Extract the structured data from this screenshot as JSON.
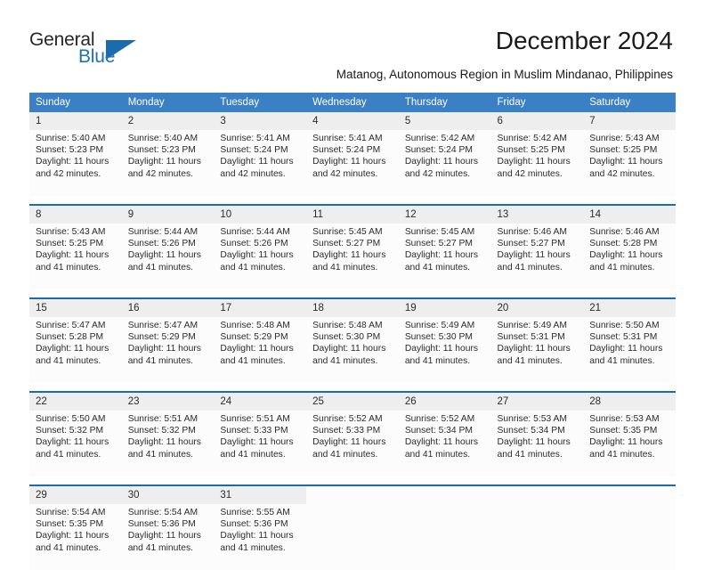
{
  "brand": {
    "name_part1": "General",
    "name_part2": "Blue",
    "accent_color": "#1b6cad",
    "triangle_icon": "triangle-icon"
  },
  "header": {
    "month_title": "December 2024",
    "location": "Matanog, Autonomous Region in Muslim Mindanao, Philippines"
  },
  "theme": {
    "header_row_bg": "#3b7fc4",
    "daynum_bg": "#eeeeee",
    "cell_bg": "#fcfcfc",
    "separator": "#1b6cad",
    "text": "#2b2b2b"
  },
  "calendar": {
    "weekday_headers": [
      "Sunday",
      "Monday",
      "Tuesday",
      "Wednesday",
      "Thursday",
      "Friday",
      "Saturday"
    ],
    "weeks": [
      [
        {
          "day": "1",
          "sunrise": "Sunrise: 5:40 AM",
          "sunset": "Sunset: 5:23 PM",
          "daylight_1": "Daylight: 11 hours",
          "daylight_2": "and 42 minutes."
        },
        {
          "day": "2",
          "sunrise": "Sunrise: 5:40 AM",
          "sunset": "Sunset: 5:23 PM",
          "daylight_1": "Daylight: 11 hours",
          "daylight_2": "and 42 minutes."
        },
        {
          "day": "3",
          "sunrise": "Sunrise: 5:41 AM",
          "sunset": "Sunset: 5:24 PM",
          "daylight_1": "Daylight: 11 hours",
          "daylight_2": "and 42 minutes."
        },
        {
          "day": "4",
          "sunrise": "Sunrise: 5:41 AM",
          "sunset": "Sunset: 5:24 PM",
          "daylight_1": "Daylight: 11 hours",
          "daylight_2": "and 42 minutes."
        },
        {
          "day": "5",
          "sunrise": "Sunrise: 5:42 AM",
          "sunset": "Sunset: 5:24 PM",
          "daylight_1": "Daylight: 11 hours",
          "daylight_2": "and 42 minutes."
        },
        {
          "day": "6",
          "sunrise": "Sunrise: 5:42 AM",
          "sunset": "Sunset: 5:25 PM",
          "daylight_1": "Daylight: 11 hours",
          "daylight_2": "and 42 minutes."
        },
        {
          "day": "7",
          "sunrise": "Sunrise: 5:43 AM",
          "sunset": "Sunset: 5:25 PM",
          "daylight_1": "Daylight: 11 hours",
          "daylight_2": "and 42 minutes."
        }
      ],
      [
        {
          "day": "8",
          "sunrise": "Sunrise: 5:43 AM",
          "sunset": "Sunset: 5:25 PM",
          "daylight_1": "Daylight: 11 hours",
          "daylight_2": "and 41 minutes."
        },
        {
          "day": "9",
          "sunrise": "Sunrise: 5:44 AM",
          "sunset": "Sunset: 5:26 PM",
          "daylight_1": "Daylight: 11 hours",
          "daylight_2": "and 41 minutes."
        },
        {
          "day": "10",
          "sunrise": "Sunrise: 5:44 AM",
          "sunset": "Sunset: 5:26 PM",
          "daylight_1": "Daylight: 11 hours",
          "daylight_2": "and 41 minutes."
        },
        {
          "day": "11",
          "sunrise": "Sunrise: 5:45 AM",
          "sunset": "Sunset: 5:27 PM",
          "daylight_1": "Daylight: 11 hours",
          "daylight_2": "and 41 minutes."
        },
        {
          "day": "12",
          "sunrise": "Sunrise: 5:45 AM",
          "sunset": "Sunset: 5:27 PM",
          "daylight_1": "Daylight: 11 hours",
          "daylight_2": "and 41 minutes."
        },
        {
          "day": "13",
          "sunrise": "Sunrise: 5:46 AM",
          "sunset": "Sunset: 5:27 PM",
          "daylight_1": "Daylight: 11 hours",
          "daylight_2": "and 41 minutes."
        },
        {
          "day": "14",
          "sunrise": "Sunrise: 5:46 AM",
          "sunset": "Sunset: 5:28 PM",
          "daylight_1": "Daylight: 11 hours",
          "daylight_2": "and 41 minutes."
        }
      ],
      [
        {
          "day": "15",
          "sunrise": "Sunrise: 5:47 AM",
          "sunset": "Sunset: 5:28 PM",
          "daylight_1": "Daylight: 11 hours",
          "daylight_2": "and 41 minutes."
        },
        {
          "day": "16",
          "sunrise": "Sunrise: 5:47 AM",
          "sunset": "Sunset: 5:29 PM",
          "daylight_1": "Daylight: 11 hours",
          "daylight_2": "and 41 minutes."
        },
        {
          "day": "17",
          "sunrise": "Sunrise: 5:48 AM",
          "sunset": "Sunset: 5:29 PM",
          "daylight_1": "Daylight: 11 hours",
          "daylight_2": "and 41 minutes."
        },
        {
          "day": "18",
          "sunrise": "Sunrise: 5:48 AM",
          "sunset": "Sunset: 5:30 PM",
          "daylight_1": "Daylight: 11 hours",
          "daylight_2": "and 41 minutes."
        },
        {
          "day": "19",
          "sunrise": "Sunrise: 5:49 AM",
          "sunset": "Sunset: 5:30 PM",
          "daylight_1": "Daylight: 11 hours",
          "daylight_2": "and 41 minutes."
        },
        {
          "day": "20",
          "sunrise": "Sunrise: 5:49 AM",
          "sunset": "Sunset: 5:31 PM",
          "daylight_1": "Daylight: 11 hours",
          "daylight_2": "and 41 minutes."
        },
        {
          "day": "21",
          "sunrise": "Sunrise: 5:50 AM",
          "sunset": "Sunset: 5:31 PM",
          "daylight_1": "Daylight: 11 hours",
          "daylight_2": "and 41 minutes."
        }
      ],
      [
        {
          "day": "22",
          "sunrise": "Sunrise: 5:50 AM",
          "sunset": "Sunset: 5:32 PM",
          "daylight_1": "Daylight: 11 hours",
          "daylight_2": "and 41 minutes."
        },
        {
          "day": "23",
          "sunrise": "Sunrise: 5:51 AM",
          "sunset": "Sunset: 5:32 PM",
          "daylight_1": "Daylight: 11 hours",
          "daylight_2": "and 41 minutes."
        },
        {
          "day": "24",
          "sunrise": "Sunrise: 5:51 AM",
          "sunset": "Sunset: 5:33 PM",
          "daylight_1": "Daylight: 11 hours",
          "daylight_2": "and 41 minutes."
        },
        {
          "day": "25",
          "sunrise": "Sunrise: 5:52 AM",
          "sunset": "Sunset: 5:33 PM",
          "daylight_1": "Daylight: 11 hours",
          "daylight_2": "and 41 minutes."
        },
        {
          "day": "26",
          "sunrise": "Sunrise: 5:52 AM",
          "sunset": "Sunset: 5:34 PM",
          "daylight_1": "Daylight: 11 hours",
          "daylight_2": "and 41 minutes."
        },
        {
          "day": "27",
          "sunrise": "Sunrise: 5:53 AM",
          "sunset": "Sunset: 5:34 PM",
          "daylight_1": "Daylight: 11 hours",
          "daylight_2": "and 41 minutes."
        },
        {
          "day": "28",
          "sunrise": "Sunrise: 5:53 AM",
          "sunset": "Sunset: 5:35 PM",
          "daylight_1": "Daylight: 11 hours",
          "daylight_2": "and 41 minutes."
        }
      ],
      [
        {
          "day": "29",
          "sunrise": "Sunrise: 5:54 AM",
          "sunset": "Sunset: 5:35 PM",
          "daylight_1": "Daylight: 11 hours",
          "daylight_2": "and 41 minutes."
        },
        {
          "day": "30",
          "sunrise": "Sunrise: 5:54 AM",
          "sunset": "Sunset: 5:36 PM",
          "daylight_1": "Daylight: 11 hours",
          "daylight_2": "and 41 minutes."
        },
        {
          "day": "31",
          "sunrise": "Sunrise: 5:55 AM",
          "sunset": "Sunset: 5:36 PM",
          "daylight_1": "Daylight: 11 hours",
          "daylight_2": "and 41 minutes."
        },
        {
          "day": "",
          "sunrise": "",
          "sunset": "",
          "daylight_1": "",
          "daylight_2": ""
        },
        {
          "day": "",
          "sunrise": "",
          "sunset": "",
          "daylight_1": "",
          "daylight_2": ""
        },
        {
          "day": "",
          "sunrise": "",
          "sunset": "",
          "daylight_1": "",
          "daylight_2": ""
        },
        {
          "day": "",
          "sunrise": "",
          "sunset": "",
          "daylight_1": "",
          "daylight_2": ""
        }
      ]
    ]
  }
}
